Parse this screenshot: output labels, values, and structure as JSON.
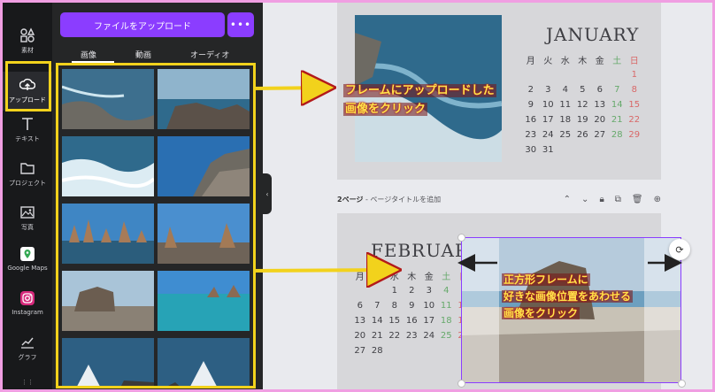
{
  "rail": {
    "items": [
      {
        "name": "elements",
        "label": "素材"
      },
      {
        "name": "upload",
        "label": "アップロード"
      },
      {
        "name": "text",
        "label": "テキスト"
      },
      {
        "name": "projects",
        "label": "プロジェクト"
      },
      {
        "name": "photos",
        "label": "写真"
      },
      {
        "name": "google-maps",
        "label": "Google Maps"
      },
      {
        "name": "instagram",
        "label": "Instagram"
      },
      {
        "name": "charts",
        "label": "グラフ"
      }
    ]
  },
  "panel": {
    "upload_label": "ファイルをアップロード",
    "more_label": "•••",
    "tabs": [
      "画像",
      "動画",
      "オーディオ"
    ]
  },
  "page1": {
    "month": "JANUARY",
    "weekdays": [
      "月",
      "火",
      "水",
      "木",
      "金",
      "土",
      "日"
    ],
    "weeks": [
      [
        "",
        "",
        "",
        "",
        "",
        "",
        "1"
      ],
      [
        "2",
        "3",
        "4",
        "5",
        "6",
        "7",
        "8"
      ],
      [
        "9",
        "10",
        "11",
        "12",
        "13",
        "14",
        "15"
      ],
      [
        "16",
        "17",
        "18",
        "19",
        "20",
        "21",
        "22"
      ],
      [
        "23",
        "24",
        "25",
        "26",
        "27",
        "28",
        "29"
      ],
      [
        "30",
        "31",
        "",
        "",
        "",
        "",
        ""
      ]
    ]
  },
  "page_bar": {
    "number": "2ページ",
    "separator": " - ",
    "title_placeholder": "ページタイトルを追加"
  },
  "page2": {
    "month": "FEBRUARY",
    "weekdays": [
      "月",
      "火",
      "水",
      "木",
      "金",
      "土",
      "日"
    ],
    "weeks": [
      [
        "",
        "",
        "1",
        "2",
        "3",
        "4",
        "5"
      ],
      [
        "6",
        "7",
        "8",
        "9",
        "10",
        "11",
        "12"
      ],
      [
        "13",
        "14",
        "15",
        "16",
        "17",
        "18",
        "19"
      ],
      [
        "20",
        "21",
        "22",
        "23",
        "24",
        "25",
        "26"
      ],
      [
        "27",
        "28",
        "",
        "",
        "",
        "",
        ""
      ]
    ]
  },
  "callouts": {
    "first_line1": "フレームにアップロードした",
    "first_line2": "画像をクリック",
    "second_line1": "正方形フレームに",
    "second_line2": "好きな画像位置をあわせる",
    "second_line3": "画像をクリック"
  },
  "colors": {
    "accent": "#8b3dff",
    "highlight": "#f2d21c",
    "frame_pink": "#f09ee2",
    "saturday": "#66a96b",
    "sunday": "#d86868"
  }
}
